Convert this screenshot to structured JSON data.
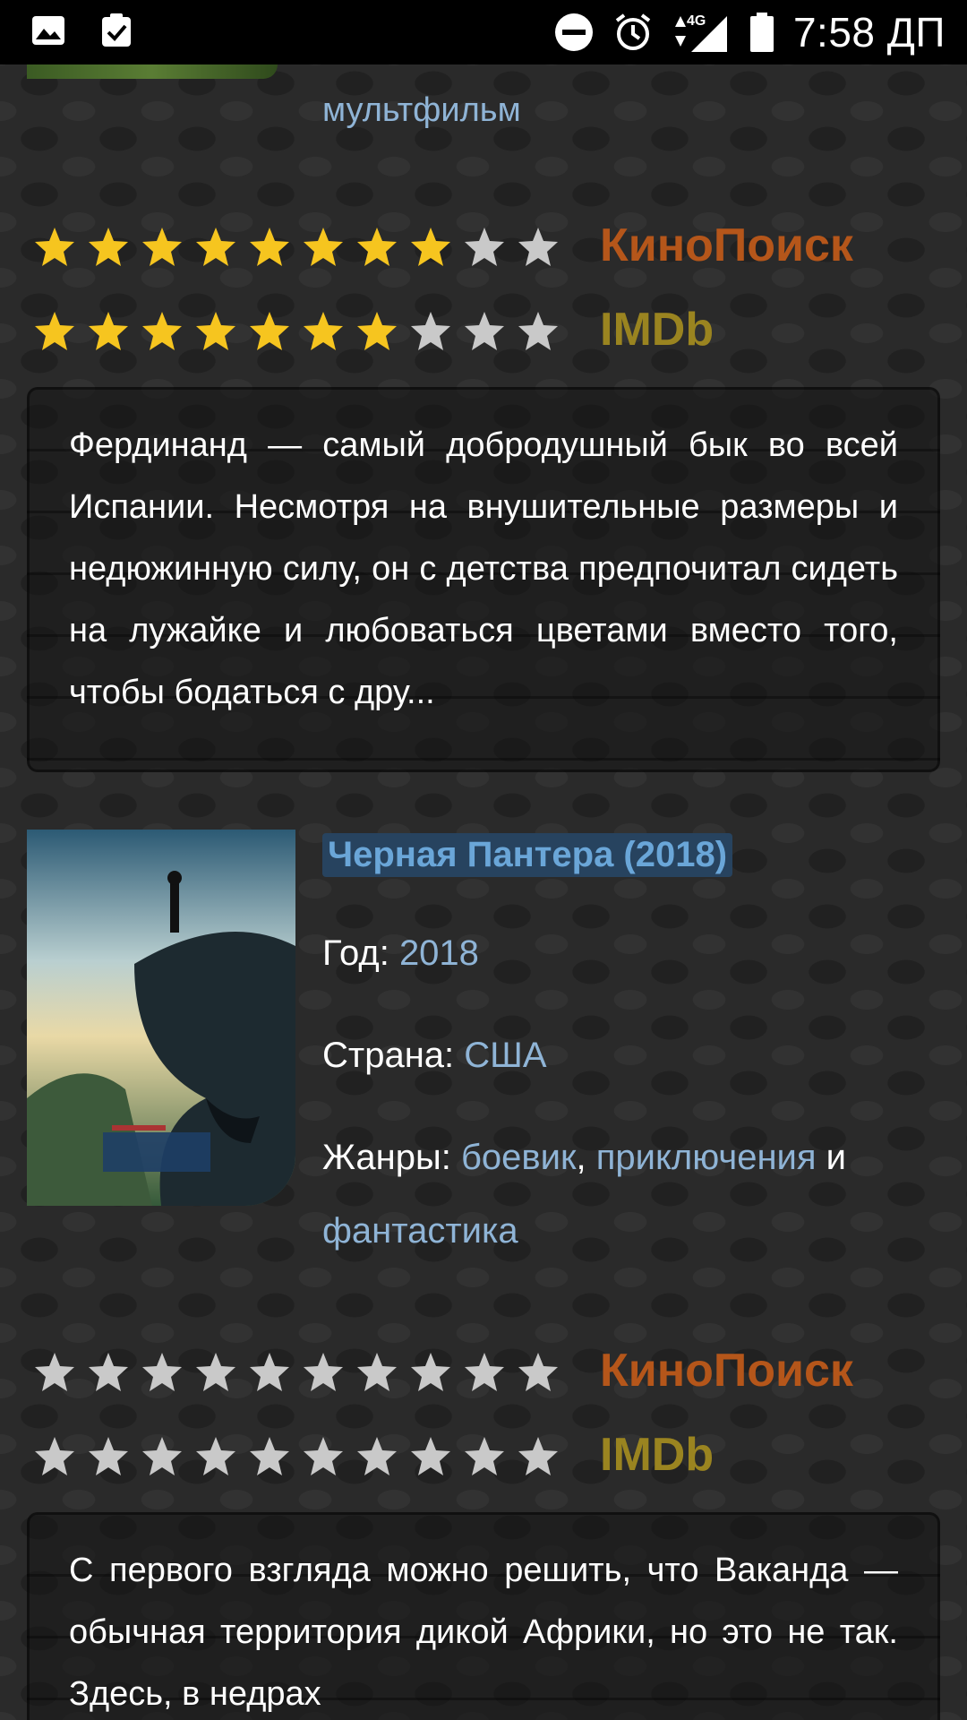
{
  "status_bar": {
    "time": "7:58 ДП",
    "network": "4G"
  },
  "prev_movie": {
    "genre_tail": "мультфильм",
    "ratings": [
      {
        "source": "КиноПоиск",
        "filled": 8,
        "max": 10
      },
      {
        "source": "IMDb",
        "filled": 7,
        "max": 10
      }
    ],
    "description": "Фердинанд — самый добродушный бык во всей Испании. Несмотря на внушительные размеры и недюжинную силу, он с детства предпочитал сидеть на лужайке и любоваться цветами вместо того, чтобы бодаться с дру..."
  },
  "movie": {
    "title": "Черная Пантера (2018)",
    "year_label": "Год:",
    "year": "2018",
    "country_label": "Страна:",
    "country": "США",
    "genres_label": "Жанры:",
    "genres": [
      "боевик",
      "приключения",
      "фантастика"
    ],
    "genre_sep": ",",
    "genre_and": "и",
    "ratings": [
      {
        "source": "КиноПоиск",
        "filled": 0,
        "max": 10
      },
      {
        "source": "IMDb",
        "filled": 0,
        "max": 10
      }
    ],
    "description": "С первого взгляда можно решить, что Ваканда — обычная территория дикой Африки, но это не так. Здесь, в недрах"
  },
  "colors": {
    "star_filled": "#f6c51f",
    "star_empty": "#c9c9c9",
    "kinopoisk": "#b5561a",
    "imdb": "#9a8420",
    "link": "#8fb4d6",
    "title_highlight": "#27435f"
  }
}
